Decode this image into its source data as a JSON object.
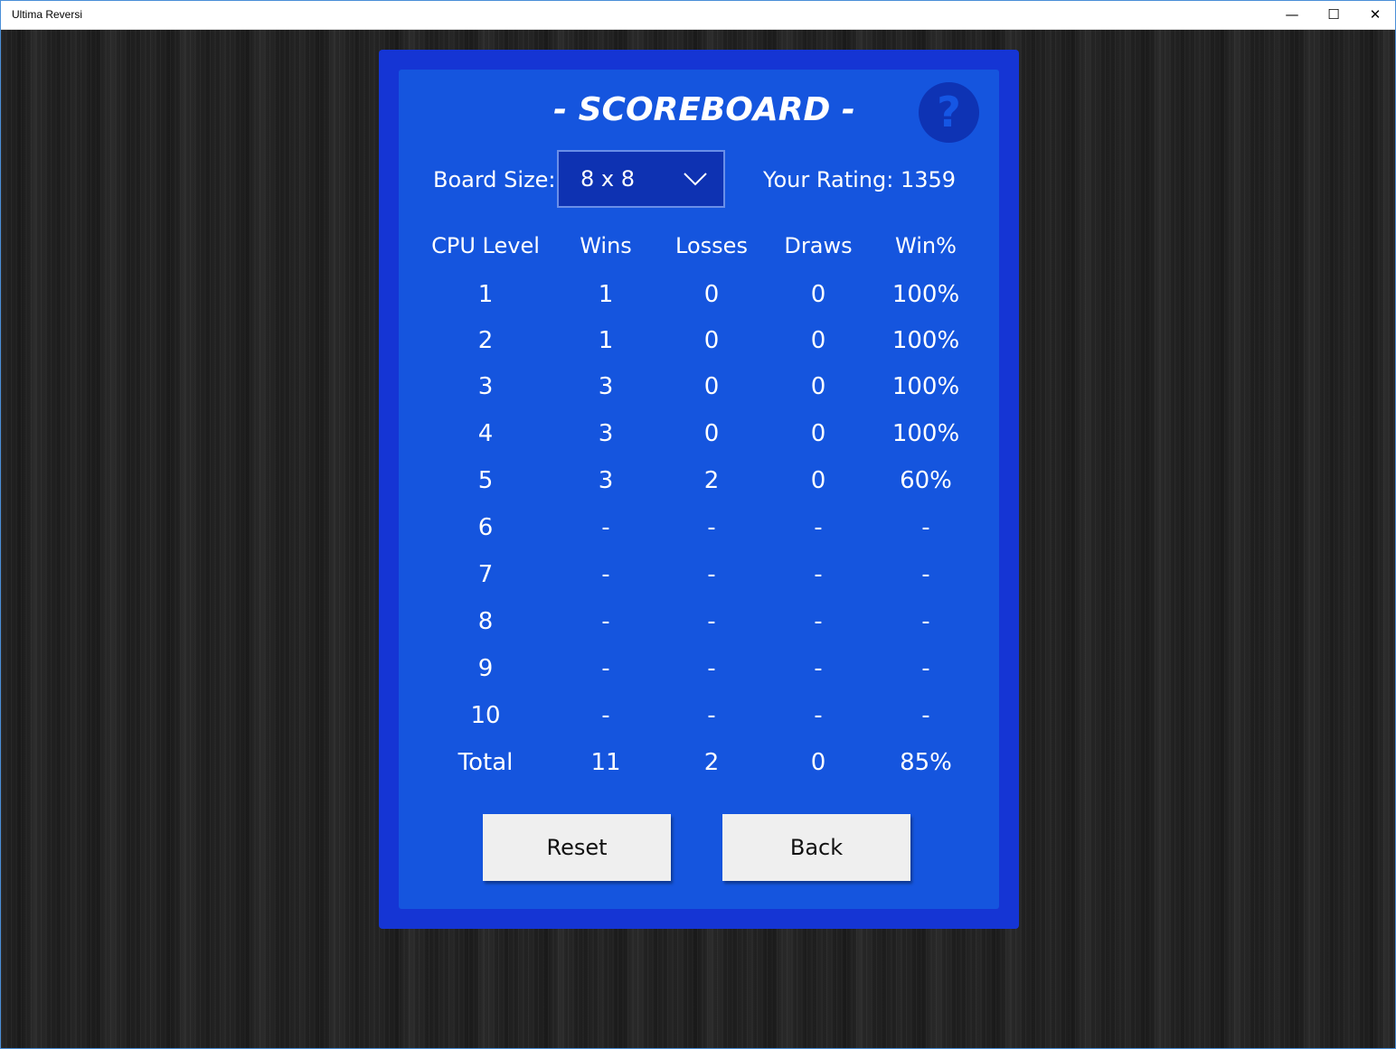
{
  "window": {
    "title": "Ultima Reversi",
    "minimize_glyph": "—",
    "maximize_glyph": "☐",
    "close_glyph": "✕"
  },
  "scoreboard": {
    "title": "- SCOREBOARD -",
    "help_glyph": "?",
    "board_size_label": "Board Size:",
    "board_size_value": "8 x 8",
    "rating_label": "Your Rating: 1359",
    "columns": [
      "CPU Level",
      "Wins",
      "Losses",
      "Draws",
      "Win%"
    ],
    "rows": [
      [
        "1",
        "1",
        "0",
        "0",
        "100%"
      ],
      [
        "2",
        "1",
        "0",
        "0",
        "100%"
      ],
      [
        "3",
        "3",
        "0",
        "0",
        "100%"
      ],
      [
        "4",
        "3",
        "0",
        "0",
        "100%"
      ],
      [
        "5",
        "3",
        "2",
        "0",
        "60%"
      ],
      [
        "6",
        "-",
        "-",
        "-",
        "-"
      ],
      [
        "7",
        "-",
        "-",
        "-",
        "-"
      ],
      [
        "8",
        "-",
        "-",
        "-",
        "-"
      ],
      [
        "9",
        "-",
        "-",
        "-",
        "-"
      ],
      [
        "10",
        "-",
        "-",
        "-",
        "-"
      ],
      [
        "Total",
        "11",
        "2",
        "0",
        "85%"
      ]
    ],
    "reset_label": "Reset",
    "back_label": "Back"
  },
  "colors": {
    "panel_border": "#1535d4",
    "panel_fill": "#1555de",
    "help_circle": "#0e33b4",
    "dropdown_fill": "#0e32b2",
    "button_fill": "#efefef"
  }
}
